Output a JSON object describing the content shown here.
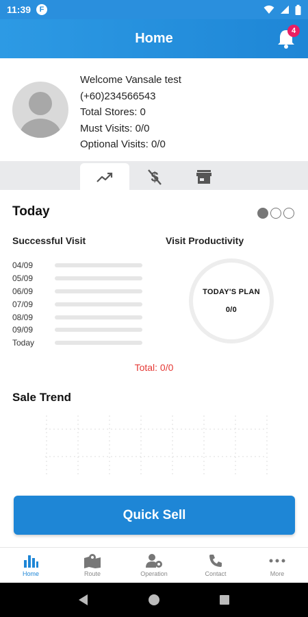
{
  "status_bar": {
    "time": "11:39",
    "notification_letter": "F"
  },
  "app_bar": {
    "title": "Home",
    "notification_count": "4"
  },
  "profile": {
    "welcome_prefix": "Welcome",
    "username": "Vansale test",
    "phone": "(+60)234566543",
    "total_stores": "Total Stores: 0",
    "must_visits": "Must Visits: 0/0",
    "optional_visits": "Optional Visits: 0/0"
  },
  "tabs": [
    {
      "icon": "trending-up-icon",
      "active": true
    },
    {
      "icon": "dollar-off-icon",
      "active": false
    },
    {
      "icon": "store-icon",
      "active": false
    }
  ],
  "today": {
    "title": "Today",
    "pager_active_index": 0,
    "pager_count": 3,
    "successful_visit_label": "Successful Visit",
    "visit_productivity_label": "Visit Productivity",
    "visit_days": [
      "04/09",
      "05/09",
      "06/09",
      "07/09",
      "08/09",
      "09/09",
      "Today"
    ],
    "plan_label": "TODAY'S PLAN",
    "plan_value": "0/0",
    "total": "Total: 0/0"
  },
  "sale_trend": {
    "title": "Sale Trend"
  },
  "quick_sell_label": "Quick Sell",
  "bottom_nav": [
    {
      "label": "Home",
      "icon": "bar-chart-icon",
      "active": true
    },
    {
      "label": "Route",
      "icon": "map-icon",
      "active": false
    },
    {
      "label": "Operation",
      "icon": "user-gear-icon",
      "active": false
    },
    {
      "label": "Contact",
      "icon": "phone-icon",
      "active": false
    },
    {
      "label": "More",
      "icon": "more-icon",
      "active": false
    }
  ],
  "colors": {
    "primary": "#1e86d6",
    "badge": "#e91e63",
    "total_text": "#e53935"
  }
}
